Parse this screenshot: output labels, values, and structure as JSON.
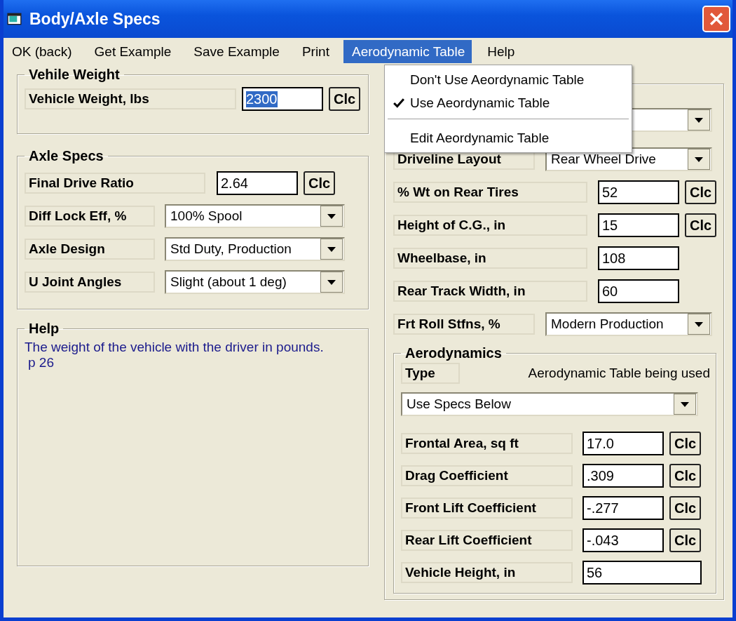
{
  "window": {
    "title": "Body/Axle Specs"
  },
  "menu": [
    {
      "label": "OK (back)",
      "selected": false
    },
    {
      "label": "Get Example",
      "selected": false
    },
    {
      "label": "Save Example",
      "selected": false
    },
    {
      "label": "Print",
      "selected": false
    },
    {
      "label": "Aerodynamic Table",
      "selected": true
    },
    {
      "label": "Help",
      "selected": false
    }
  ],
  "dropdown_menu": {
    "items": [
      {
        "kind": "item",
        "label": "Don't Use Aeordynamic Table",
        "checked": false
      },
      {
        "kind": "item",
        "label": "Use Aeordynamic Table",
        "checked": true
      },
      {
        "kind": "separator"
      },
      {
        "kind": "item",
        "label": "Edit Aeordynamic Table",
        "checked": false
      }
    ]
  },
  "vehicle_weight": {
    "title": "Vehile Weight",
    "rows": [
      {
        "kind": "text",
        "label": "Vehicle Weight, lbs",
        "value": "2300",
        "selected": true,
        "button": "Clc"
      }
    ]
  },
  "axle_specs": {
    "title": "Axle Specs",
    "rows": [
      {
        "kind": "text",
        "label": "Final Drive Ratio",
        "value": "2.64",
        "selected": false,
        "button": "Clc"
      },
      {
        "kind": "select",
        "label": "Diff Lock Eff, %",
        "value": "100% Spool"
      },
      {
        "kind": "select",
        "label": "Axle Design",
        "value": "Std Duty, Production"
      },
      {
        "kind": "select",
        "label": "U Joint Angles",
        "value": "Slight (about 1 deg)"
      }
    ]
  },
  "help": {
    "title": "Help",
    "lines": [
      "The weight of the vehicle with the driver in pounds.",
      "p 26"
    ]
  },
  "chassis": {
    "rows": [
      {
        "kind": "select"
      },
      {
        "kind": "select",
        "label": "Driveline Layout",
        "value": "Rear Wheel Drive"
      },
      {
        "kind": "text",
        "label": "% Wt on Rear Tires",
        "value": "52",
        "selected": false,
        "button": "Clc"
      },
      {
        "kind": "text",
        "label": "Height of C.G., in",
        "value": "15",
        "selected": false,
        "button": "Clc"
      },
      {
        "kind": "text",
        "label": "Wheelbase, in",
        "value": "108",
        "selected": false
      },
      {
        "kind": "text",
        "label": "Rear Track Width, in",
        "value": "60",
        "selected": false
      },
      {
        "kind": "select",
        "label": "Frt Roll Stfns, %",
        "value": "Modern Production"
      }
    ]
  },
  "aerodynamics": {
    "title": "Aerodynamics",
    "type_label": "Type",
    "status": "Aerodynamic Table being used",
    "type_value": "Use Specs Below",
    "rows": [
      {
        "kind": "text",
        "label": "Frontal Area, sq ft",
        "value": "17.0",
        "selected": false,
        "button": "Clc"
      },
      {
        "kind": "text",
        "label": "Drag Coefficient",
        "value": ".309",
        "selected": false,
        "button": "Clc"
      },
      {
        "kind": "text",
        "label": "Front Lift Coefficient",
        "value": "-.277",
        "selected": false,
        "button": "Clc"
      },
      {
        "kind": "text",
        "label": "Rear Lift Coefficient",
        "value": "-.043",
        "selected": false,
        "button": "Clc"
      },
      {
        "kind": "text",
        "label": "Vehicle Height, in",
        "value": "56",
        "selected": false
      }
    ]
  }
}
